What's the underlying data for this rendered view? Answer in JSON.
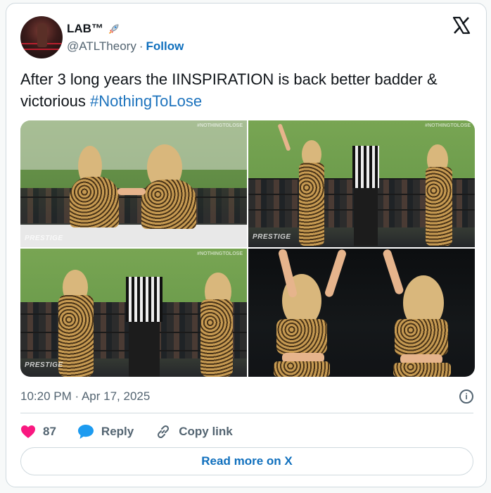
{
  "author": {
    "name": "LAB™",
    "emoji": "🚀",
    "handle": "@ATLTheory",
    "separator": "·",
    "follow_label": "Follow"
  },
  "tweet": {
    "text": "After 3 long years the IINSPIRATION is back better badder & victorious ",
    "hashtag": "#NothingToLose"
  },
  "media": {
    "watermark": "#NOTHINGTOLOSE",
    "logo_text": "PRESTIGE"
  },
  "meta": {
    "time": "10:20 PM",
    "separator": "·",
    "date": "Apr 17, 2025",
    "info_glyph": "i"
  },
  "actions": {
    "likes_count": "87",
    "reply_label": "Reply",
    "copy_label": "Copy link"
  },
  "read_more_label": "Read more on X",
  "icons": {
    "like": "heart-icon",
    "reply": "speech-bubble-icon",
    "copy": "link-icon",
    "logo": "x-logo-icon",
    "info": "info-icon"
  },
  "colors": {
    "link_blue": "#0f6fbd",
    "hashtag_blue": "#1d73bd",
    "heart_pink": "#f91880",
    "reply_blue": "#1d9bf0",
    "muted_gray": "#536471",
    "border": "#cfd9de"
  }
}
